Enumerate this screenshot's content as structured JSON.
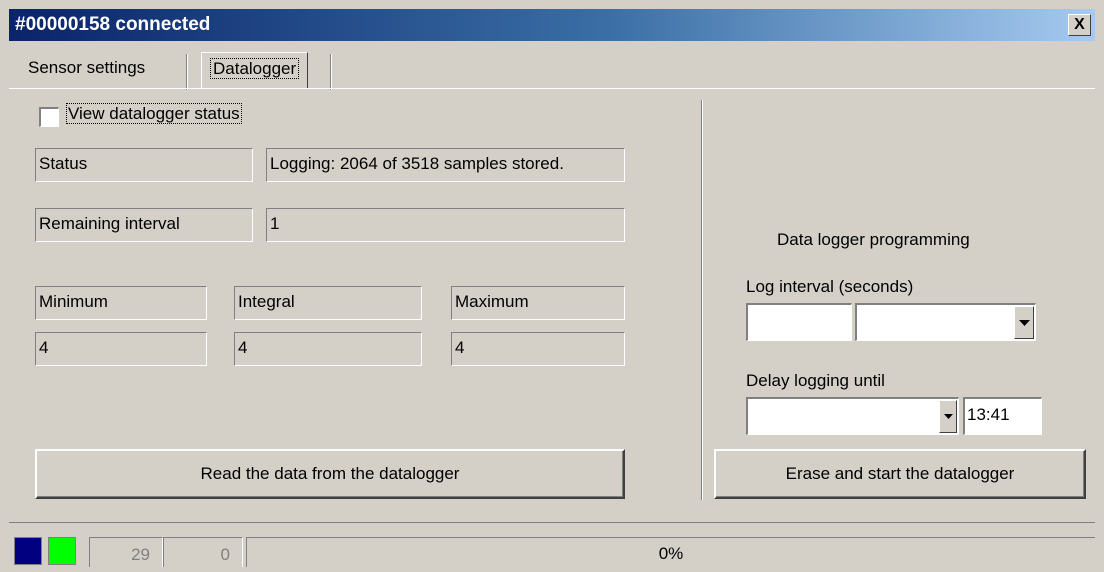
{
  "window": {
    "title": "#00000158 connected",
    "close_glyph": "X"
  },
  "tabs": [
    {
      "label": "Sensor settings",
      "active": false
    },
    {
      "label": "Datalogger",
      "active": true
    }
  ],
  "status_section": {
    "view_status_checkbox": {
      "label": "View datalogger status",
      "checked": false
    },
    "status_label": "Status",
    "status_value": "Logging: 2064 of 3518 samples stored.",
    "remaining_label": "Remaining interval",
    "remaining_value": "1",
    "minimum_label": "Minimum",
    "integral_label": "Integral",
    "maximum_label": "Maximum",
    "minimum_value": "4",
    "integral_value": "4",
    "maximum_value": "4",
    "read_button": "Read the data from the datalogger"
  },
  "programming": {
    "heading": "Data logger programming",
    "log_interval_label": "Log interval (seconds)",
    "log_interval_value": "",
    "log_interval_unit_selected": "",
    "delay_label": "Delay logging until",
    "delay_date_selected": "",
    "delay_time": "13:41",
    "erase_button": "Erase and start the datalogger"
  },
  "statusbar": {
    "indicator_colors": [
      "#000080",
      "#00ff00"
    ],
    "counter_1": "29",
    "counter_2": "0",
    "progress_percent": 0,
    "progress_text": "0%"
  },
  "icons": {
    "dropdown": "chevron-down-icon",
    "close": "close-icon"
  }
}
